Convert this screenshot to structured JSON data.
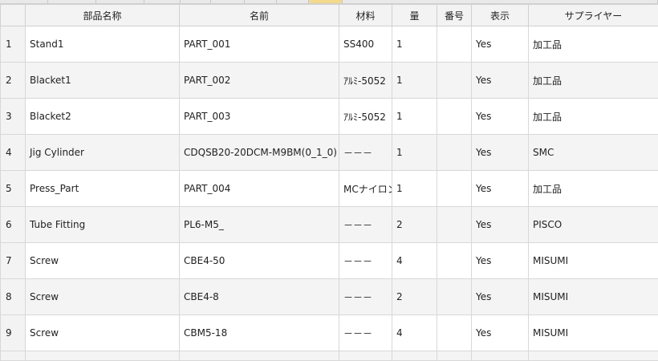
{
  "table": {
    "columns": [
      "部品名称",
      "名前",
      "材料",
      "量",
      "番号",
      "表示",
      "サプライヤー"
    ],
    "rows": [
      {
        "index": "1",
        "cells": [
          "Stand1",
          "PART_001",
          "SS400",
          "1",
          "",
          "Yes",
          "加工品"
        ]
      },
      {
        "index": "2",
        "cells": [
          "Blacket1",
          "PART_002",
          "ｱﾙﾐ-5052",
          "1",
          "",
          "Yes",
          "加工品"
        ]
      },
      {
        "index": "3",
        "cells": [
          "Blacket2",
          "PART_003",
          "ｱﾙﾐ-5052",
          "1",
          "",
          "Yes",
          "加工品"
        ]
      },
      {
        "index": "4",
        "cells": [
          "Jig Cylinder",
          "CDQSB20-20DCM-M9BM(0_1_0)",
          "－－－",
          "1",
          "",
          "Yes",
          "SMC"
        ]
      },
      {
        "index": "5",
        "cells": [
          "Press_Part",
          "PART_004",
          "MCナイロン",
          "1",
          "",
          "Yes",
          "加工品"
        ]
      },
      {
        "index": "6",
        "cells": [
          "Tube Fitting",
          "PL6-M5_",
          "－－－",
          "2",
          "",
          "Yes",
          "PISCO"
        ]
      },
      {
        "index": "7",
        "cells": [
          "Screw",
          "CBE4-50",
          "－－－",
          "4",
          "",
          "Yes",
          "MISUMI"
        ]
      },
      {
        "index": "8",
        "cells": [
          "Screw",
          "CBE4-8",
          "－－－",
          "2",
          "",
          "Yes",
          "MISUMI"
        ]
      },
      {
        "index": "9",
        "cells": [
          "Screw",
          "CBM5-18",
          "－－－",
          "4",
          "",
          "Yes",
          "MISUMI"
        ]
      }
    ]
  }
}
